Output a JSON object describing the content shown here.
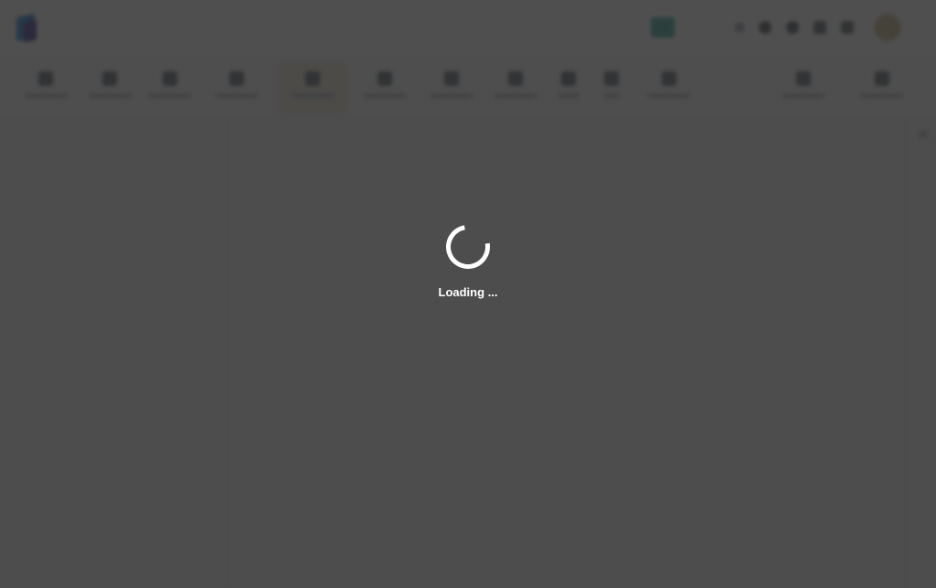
{
  "app": {
    "title": "",
    "header": {
      "links": [
        "",
        "",
        ""
      ],
      "user_name": ""
    },
    "toolbar": {
      "items": [
        "",
        "",
        "",
        "",
        "",
        "",
        "",
        "",
        "",
        "",
        "",
        "",
        ""
      ]
    }
  },
  "overlay": {
    "loading_text": "Loading ...",
    "spinner_color": "#ffffff",
    "overlay_color": "#282828"
  },
  "colors": {
    "brand_blue": "#1e7fd6",
    "brand_purple": "#3d2f8f",
    "badge_teal": "#3aa89a",
    "active_tool_bg": "#ece5d5"
  }
}
